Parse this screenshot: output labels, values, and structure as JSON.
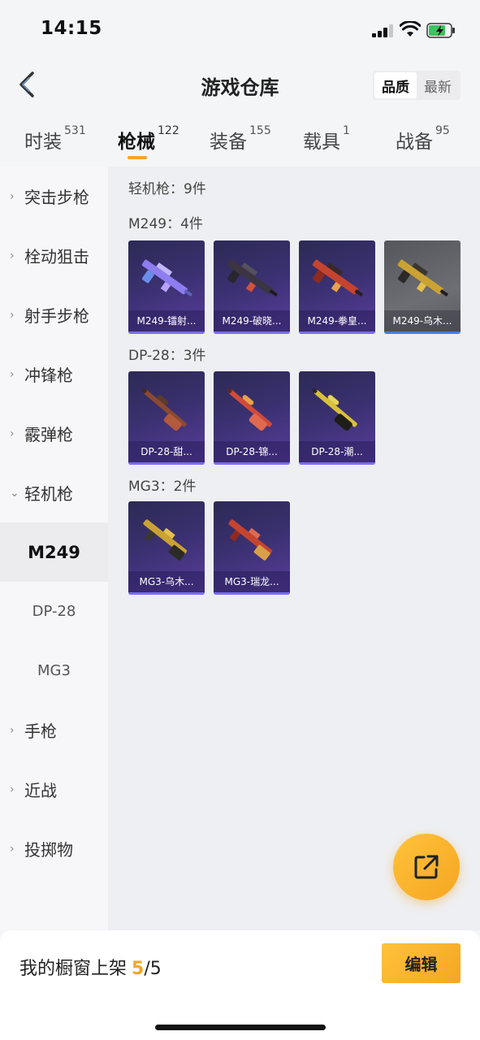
{
  "status_bar": {
    "time": "14:15"
  },
  "header": {
    "title": "游戏仓库",
    "sort_options": [
      "品质",
      "最新"
    ]
  },
  "tabs": [
    {
      "label": "时装",
      "count": "531"
    },
    {
      "label": "枪械",
      "count": "122"
    },
    {
      "label": "装备",
      "count": "155"
    },
    {
      "label": "载具",
      "count": "1"
    },
    {
      "label": "战备",
      "count": "95"
    }
  ],
  "sidebar": {
    "categories": [
      "突击步枪",
      "栓动狙击",
      "射手步枪",
      "冲锋枪",
      "霰弹枪",
      "轻机枪"
    ],
    "subitems": [
      "M249",
      "DP-28",
      "MG3"
    ],
    "more_categories": [
      "手枪",
      "近战",
      "投掷物"
    ]
  },
  "content": {
    "category_total": "轻机枪：9件",
    "groups": [
      {
        "title": "M249：4件",
        "items": [
          "M249-镭射...",
          "M249-破晓...",
          "M249-拳皇...",
          "M249-乌木..."
        ]
      },
      {
        "title": "DP-28：3件",
        "items": [
          "DP-28-甜...",
          "DP-28-锦...",
          "DP-28-潮..."
        ]
      },
      {
        "title": "MG3：2件",
        "items": [
          "MG3-乌木...",
          "MG3-瑞龙..."
        ]
      }
    ]
  },
  "bottom": {
    "showcase_label": "我的橱窗上架",
    "current": "5",
    "total": "/5",
    "edit_label": "编辑"
  },
  "colors": {
    "accent": "#f5a623",
    "card_purple": "#3a3070",
    "card_gray": "#6d6e74"
  }
}
